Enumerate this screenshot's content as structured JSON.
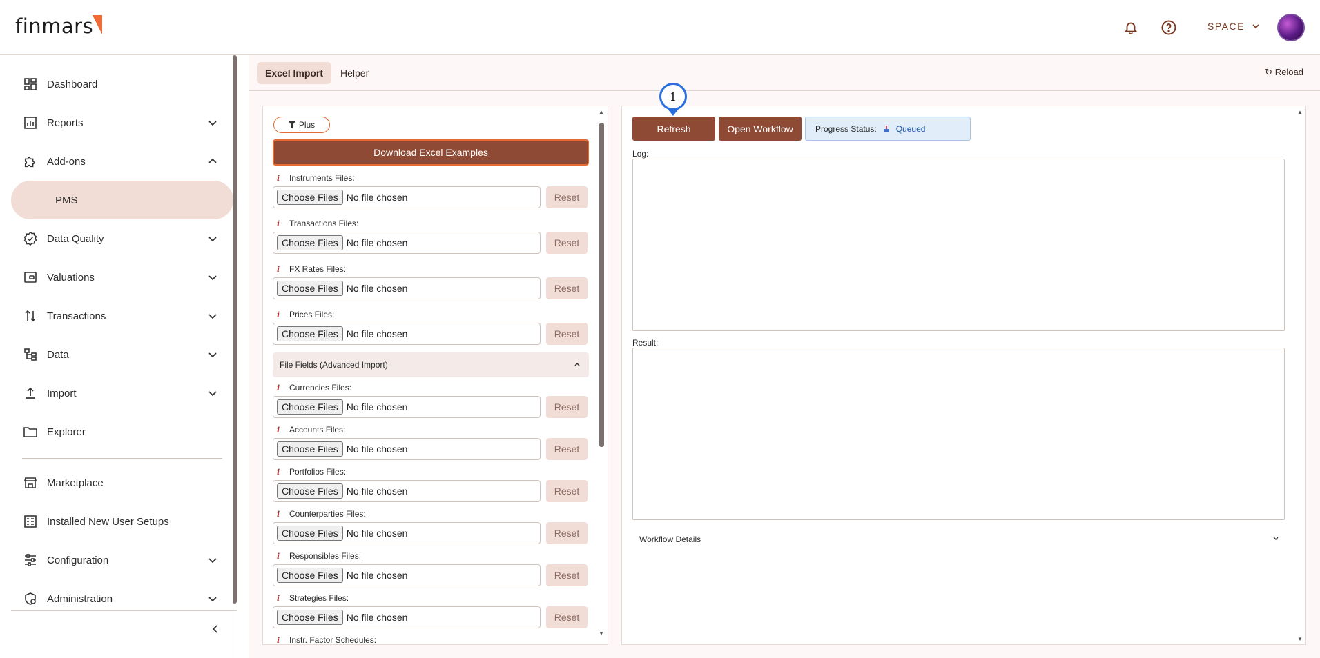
{
  "header": {
    "logo_text": "finmars",
    "space_label": "SPACE",
    "icons": [
      "bell-icon",
      "help-icon",
      "chevron-down-icon"
    ]
  },
  "sidebar": {
    "items": [
      {
        "label": "Dashboard",
        "icon": "dashboard-icon",
        "has_chevron": false
      },
      {
        "label": "Reports",
        "icon": "reports-icon",
        "has_chevron": true
      },
      {
        "label": "Add-ons",
        "icon": "puzzle-icon",
        "has_chevron": true,
        "expanded": true
      },
      {
        "label": "PMS",
        "icon": "",
        "has_chevron": false,
        "active": true
      },
      {
        "label": "Data Quality",
        "icon": "badge-check-icon",
        "has_chevron": true
      },
      {
        "label": "Valuations",
        "icon": "wallet-icon",
        "has_chevron": true
      },
      {
        "label": "Transactions",
        "icon": "transactions-icon",
        "has_chevron": true
      },
      {
        "label": "Data",
        "icon": "data-tree-icon",
        "has_chevron": true
      },
      {
        "label": "Import",
        "icon": "upload-icon",
        "has_chevron": true
      },
      {
        "label": "Explorer",
        "icon": "folder-icon",
        "has_chevron": false
      },
      {
        "label": "Marketplace",
        "icon": "store-icon",
        "has_chevron": false
      },
      {
        "label": "Installed New User Setups",
        "icon": "setups-icon",
        "has_chevron": false
      },
      {
        "label": "Configuration",
        "icon": "sliders-icon",
        "has_chevron": true
      },
      {
        "label": "Administration",
        "icon": "admin-shield-icon",
        "has_chevron": true
      }
    ]
  },
  "tabs": [
    {
      "label": "Excel Import",
      "active": true
    },
    {
      "label": "Helper",
      "active": false
    }
  ],
  "reload_label": "↻ Reload",
  "left_panel": {
    "plus_label": "Plus",
    "download_label": "Download Excel Examples",
    "choose_label": "Choose Files",
    "no_file_label": "No file chosen",
    "reset_label": "Reset",
    "info_glyph": "i",
    "advanced_header": "File Fields (Advanced Import)",
    "fields": [
      "Instruments Files:",
      "Transactions Files:",
      "FX Rates Files:",
      "Prices Files:",
      "Currencies Files:",
      "Accounts Files:",
      "Portfolios Files:",
      "Counterparties Files:",
      "Responsibles Files:",
      "Strategies Files:",
      "Instr. Factor Schedules:"
    ]
  },
  "right_panel": {
    "refresh_label": "Refresh",
    "open_workflow_label": "Open Workflow",
    "progress_label": "Progress Status:",
    "progress_value": "Queued",
    "log_label": "Log:",
    "result_label": "Result:",
    "workflow_details_label": "Workflow Details"
  },
  "annotation": {
    "badge_number": "1"
  },
  "colors": {
    "brand_brown": "#8e4a34",
    "accent_orange": "#e86a33",
    "active_pink": "#f1dcd6",
    "status_blue": "#1c56a8"
  }
}
